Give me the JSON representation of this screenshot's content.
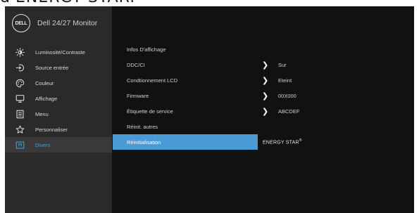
{
  "caption": "d'ENERGY STAR.",
  "header": {
    "logo": "DELL",
    "title": "Dell 24/27 Monitor"
  },
  "sidebar": {
    "items": [
      {
        "label": "Luminosité/Contraste",
        "icon": "brightness-icon"
      },
      {
        "label": "Source entrée",
        "icon": "input-source-icon"
      },
      {
        "label": "Couleur",
        "icon": "palette-icon"
      },
      {
        "label": "Affichage",
        "icon": "display-icon"
      },
      {
        "label": "Menu",
        "icon": "menu-icon"
      },
      {
        "label": "Personnaliser",
        "icon": "star-icon"
      },
      {
        "label": "Divers",
        "icon": "info-icon",
        "active": true
      }
    ]
  },
  "content": {
    "rows": [
      {
        "label": "Infos D'affichage",
        "value": "",
        "chevron": false
      },
      {
        "label": "DDC/CI",
        "value": "Sur",
        "chevron": true
      },
      {
        "label": "Condtionnement LCD",
        "value": "Eteint",
        "chevron": true
      },
      {
        "label": "Firmware",
        "value": "00X000",
        "chevron": true
      },
      {
        "label": "Étiquette de service",
        "value": "ABCDEF",
        "chevron": true
      },
      {
        "label": "Réinit. autres",
        "value": "",
        "chevron": false
      },
      {
        "label": "Réinitialisation",
        "value": "",
        "chevron": false,
        "selected": true
      }
    ],
    "energy_star": "ENERGY STAR",
    "energy_star_mark": "®"
  },
  "colors": {
    "accent": "#4a9ad6",
    "background": "#111111",
    "sidebar": "#2a2a2a"
  }
}
